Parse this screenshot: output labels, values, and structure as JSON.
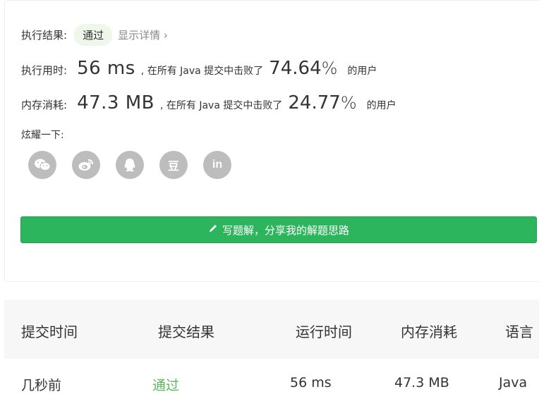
{
  "result": {
    "label": "执行结果:",
    "status": "通过",
    "details_link": "显示详情 ›"
  },
  "runtime": {
    "label": "执行用时:",
    "value": "56 ms",
    "prefix": ", 在所有 Java 提交中击败了",
    "percent": "74.64",
    "percent_sign": "%",
    "suffix": "的用户"
  },
  "memory": {
    "label": "内存消耗:",
    "value": "47.3 MB",
    "prefix": ", 在所有 Java 提交中击败了",
    "percent": "24.77",
    "percent_sign": "%",
    "suffix": "的用户"
  },
  "share": {
    "label": "炫耀一下:",
    "icons": [
      "wechat-icon",
      "weibo-icon",
      "qq-icon",
      "douban-icon",
      "linkedin-icon"
    ],
    "douban_glyph": "豆",
    "linkedin_glyph": "in"
  },
  "write_button": {
    "label": "写题解，分享我的解题思路"
  },
  "table": {
    "headers": [
      "提交时间",
      "提交结果",
      "运行时间",
      "内存消耗",
      "语言"
    ],
    "rows": [
      [
        "几秒前",
        "通过",
        "56 ms",
        "47.3 MB",
        "Java"
      ]
    ]
  },
  "colors": {
    "accent_green": "#2db55d",
    "pass_green": "#5cb85c",
    "badge_bg": "#eef7ea",
    "icon_gray": "#bdbdbd"
  }
}
